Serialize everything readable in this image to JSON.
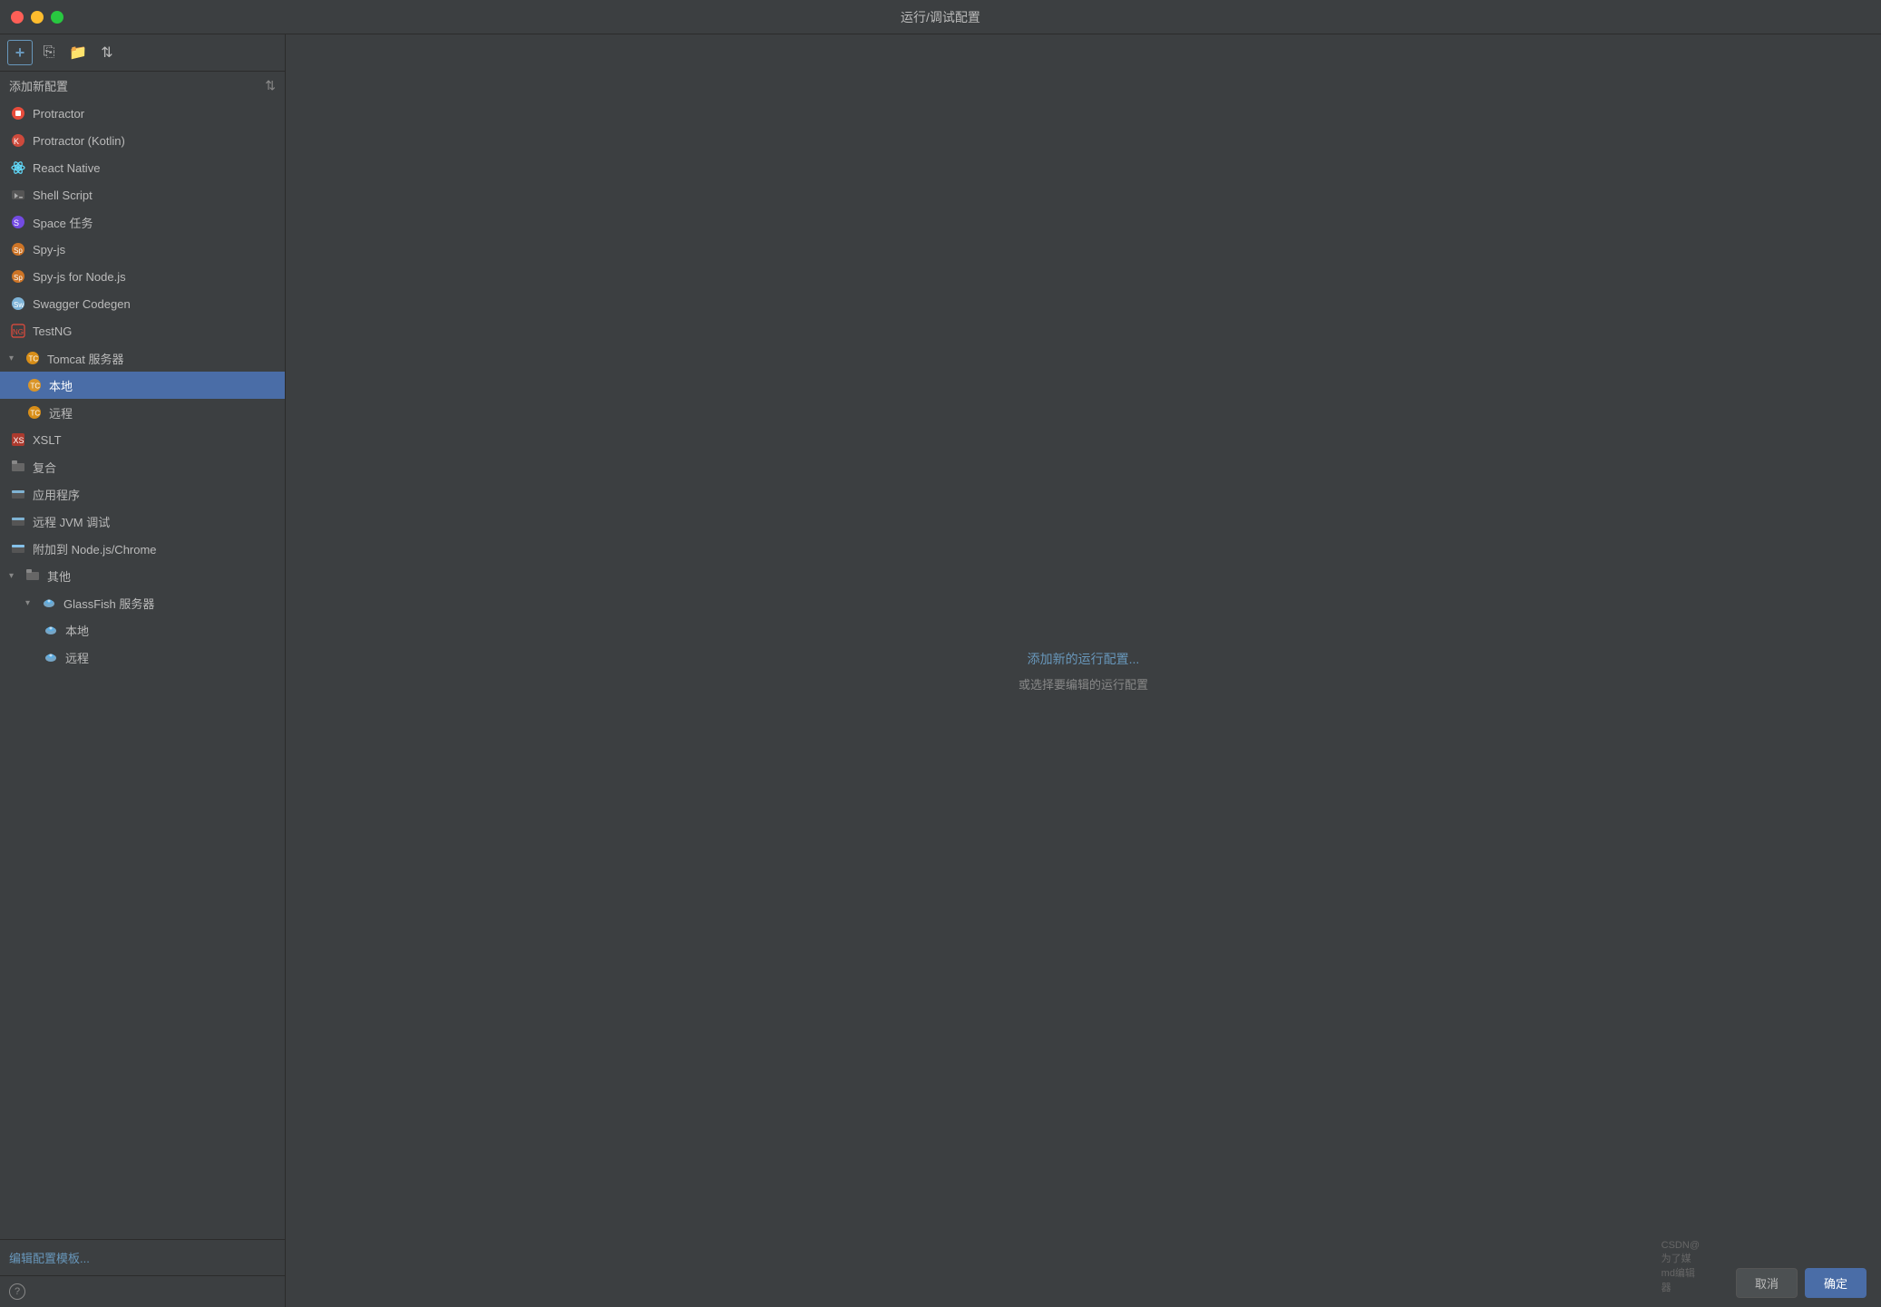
{
  "window": {
    "title": "运行/调试配置"
  },
  "toolbar": {
    "add_label": "+",
    "filter_label": "≡"
  },
  "sidebar": {
    "header": "添加新配置",
    "items": [
      {
        "id": "protractor",
        "label": "Protractor",
        "indent": 0,
        "icon": "🔴",
        "selected": false
      },
      {
        "id": "protractor-kotlin",
        "label": "Protractor (Kotlin)",
        "indent": 0,
        "icon": "🔴",
        "selected": false
      },
      {
        "id": "react-native",
        "label": "React Native",
        "indent": 0,
        "icon": "⚛",
        "selected": false
      },
      {
        "id": "shell-script",
        "label": "Shell Script",
        "indent": 0,
        "icon": "▶",
        "selected": false
      },
      {
        "id": "space-task",
        "label": "Space 任务",
        "indent": 0,
        "icon": "🌀",
        "selected": false
      },
      {
        "id": "spy-js",
        "label": "Spy-js",
        "indent": 0,
        "icon": "🕵",
        "selected": false
      },
      {
        "id": "spy-js-node",
        "label": "Spy-js for Node.js",
        "indent": 0,
        "icon": "🕵",
        "selected": false
      },
      {
        "id": "swagger-codegen",
        "label": "Swagger Codegen",
        "indent": 0,
        "icon": "📋",
        "selected": false
      },
      {
        "id": "testng",
        "label": "TestNG",
        "indent": 0,
        "icon": "NG",
        "selected": false
      },
      {
        "id": "tomcat-server",
        "label": "Tomcat 服务器",
        "indent": 0,
        "icon": "🐱",
        "expanded": true,
        "selected": false
      },
      {
        "id": "tomcat-local",
        "label": "本地",
        "indent": 1,
        "icon": "🐱",
        "selected": true
      },
      {
        "id": "tomcat-remote",
        "label": "远程",
        "indent": 1,
        "icon": "🐱",
        "selected": false
      },
      {
        "id": "xslt",
        "label": "XSLT",
        "indent": 0,
        "icon": "✖",
        "selected": false
      },
      {
        "id": "compound",
        "label": "复合",
        "indent": 0,
        "icon": "📁",
        "selected": false
      },
      {
        "id": "application",
        "label": "应用程序",
        "indent": 0,
        "icon": "🖥",
        "selected": false
      },
      {
        "id": "remote-jvm",
        "label": "远程 JVM 调试",
        "indent": 0,
        "icon": "🖥",
        "selected": false
      },
      {
        "id": "attach-nodejs",
        "label": "附加到 Node.js/Chrome",
        "indent": 0,
        "icon": "🖥",
        "selected": false
      },
      {
        "id": "other",
        "label": "其他",
        "indent": 0,
        "icon": "📁",
        "expanded": true,
        "selected": false
      },
      {
        "id": "glassfish-server",
        "label": "GlassFish 服务器",
        "indent": 1,
        "icon": "🐟",
        "expanded": true,
        "selected": false
      },
      {
        "id": "glassfish-local",
        "label": "本地",
        "indent": 2,
        "icon": "🐟",
        "selected": false
      },
      {
        "id": "glassfish-remote",
        "label": "远程",
        "indent": 2,
        "icon": "🐟",
        "selected": false
      }
    ],
    "edit_templates": "编辑配置模板..."
  },
  "main": {
    "add_link": "添加新的运行配置...",
    "hint": "或选择要编辑的运行配置"
  },
  "footer": {
    "cancel": "取消",
    "confirm": "确定",
    "watermark": "CSDN@为了媒md编辑器"
  }
}
